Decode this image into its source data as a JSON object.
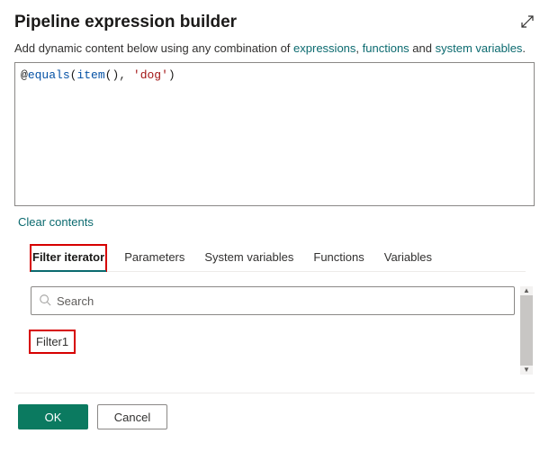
{
  "header": {
    "title": "Pipeline expression builder"
  },
  "helper": {
    "prefix": "Add dynamic content below using any combination of ",
    "link1": "expressions",
    "sep1": ", ",
    "link2": "functions",
    "sep2": " and ",
    "link3": "system variables",
    "suffix": "."
  },
  "editor": {
    "at": "@",
    "fn1": "equals",
    "open1": "(",
    "fn2": "item",
    "open2": "(",
    "close2": ")",
    "comma": ", ",
    "str": "'dog'",
    "close1": ")"
  },
  "clear_label": "Clear contents",
  "tabs": [
    {
      "label": "Filter iterator",
      "active": true,
      "highlighted": true
    },
    {
      "label": "Parameters",
      "active": false,
      "highlighted": false
    },
    {
      "label": "System variables",
      "active": false,
      "highlighted": false
    },
    {
      "label": "Functions",
      "active": false,
      "highlighted": false
    },
    {
      "label": "Variables",
      "active": false,
      "highlighted": false
    }
  ],
  "search": {
    "placeholder": "Search"
  },
  "items": [
    {
      "label": "Filter1",
      "highlighted": true
    }
  ],
  "footer": {
    "ok": "OK",
    "cancel": "Cancel"
  }
}
